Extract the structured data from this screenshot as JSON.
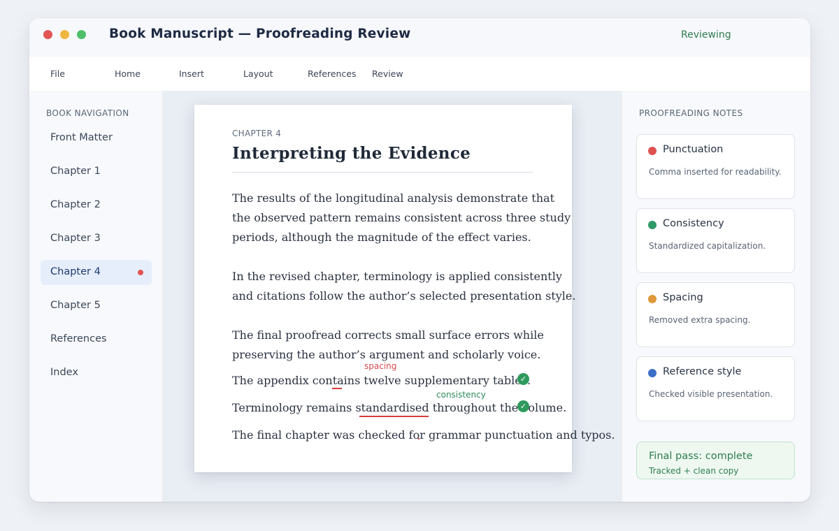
{
  "window": {
    "title": "Book Manuscript — Proofreading Review",
    "status": "Reviewing"
  },
  "menu": [
    "File",
    "Home",
    "Insert",
    "Layout",
    "References",
    "Review"
  ],
  "sidebar": {
    "heading": "BOOK NAVIGATION",
    "items": [
      {
        "label": "Front Matter"
      },
      {
        "label": "Chapter 1"
      },
      {
        "label": "Chapter 2"
      },
      {
        "label": "Chapter 3"
      },
      {
        "label": "Chapter 4",
        "active": true
      },
      {
        "label": "Chapter 5"
      },
      {
        "label": "References"
      },
      {
        "label": "Index"
      }
    ]
  },
  "document": {
    "chapter_label": "CHAPTER 4",
    "chapter_title": "Interpreting the Evidence",
    "paragraphs": [
      [
        "The results of the longitudinal analysis demonstrate that",
        "the observed pattern remains consistent across three study",
        "periods, although the magnitude of the effect varies."
      ],
      [
        "In the revised chapter, terminology is applied consistently",
        "and citations follow the author’s selected presentation style."
      ],
      [
        "The final proofread corrects small surface errors while",
        "preserving the author’s argument and scholarly voice."
      ]
    ],
    "edits": {
      "line1": "The appendix contains  twelve supplementary tables.",
      "line1_label": "spacing",
      "line2_before": "Terminology remains ",
      "line2_word": "standardised",
      "line2_after": " throughout the volume.",
      "line2_label": "consistency",
      "line3": "The final chapter was checked for grammar punctuation and typos."
    }
  },
  "notes": {
    "heading": "PROOFREADING NOTES",
    "cards": [
      {
        "title": "Punctuation",
        "desc": "Comma inserted for readability.",
        "color": "#e05252"
      },
      {
        "title": "Consistency",
        "desc": "Standardized capitalization.",
        "color": "#2e9a66"
      },
      {
        "title": "Spacing",
        "desc": "Removed extra spacing.",
        "color": "#e0983a"
      },
      {
        "title": "Reference style",
        "desc": "Checked visible presentation.",
        "color": "#3b6fc6"
      }
    ],
    "final": {
      "title": "Final pass: complete",
      "subtitle": "Tracked + clean copy"
    }
  },
  "colors": {
    "accent_green": "#2e7d4f",
    "error_red": "#d83b3b",
    "active_nav_bg": "#e6eefb"
  }
}
